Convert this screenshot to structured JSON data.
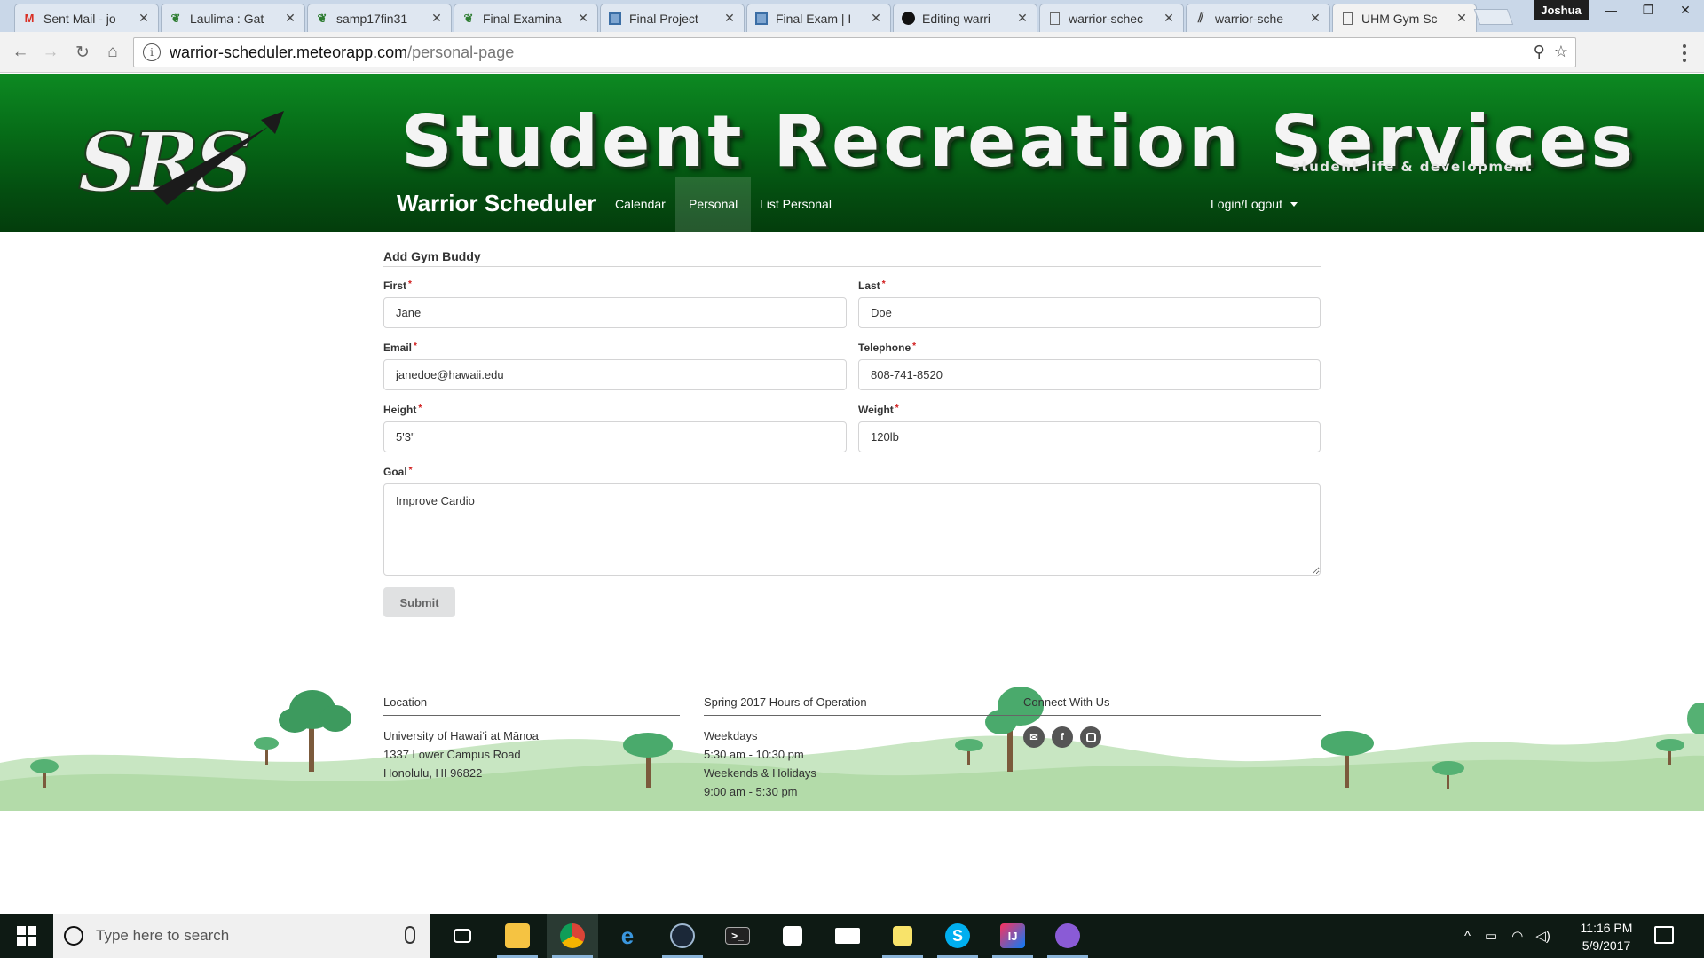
{
  "browser": {
    "tabs": [
      {
        "title": "Sent Mail - jo",
        "icon": "gmail-icon",
        "icon_color": "#d93025"
      },
      {
        "title": "Laulima : Gat",
        "icon": "laulima-icon",
        "icon_color": "#2e7d32"
      },
      {
        "title": "samp17fin31",
        "icon": "laulima-icon",
        "icon_color": "#2e7d32"
      },
      {
        "title": "Final Examina",
        "icon": "laulima-icon",
        "icon_color": "#2e7d32"
      },
      {
        "title": "Final Project",
        "icon": "course-icon",
        "icon_color": "#3b6ea5"
      },
      {
        "title": "Final Exam | I",
        "icon": "course-icon",
        "icon_color": "#3b6ea5"
      },
      {
        "title": "Editing warri",
        "icon": "github-icon",
        "icon_color": "#111111"
      },
      {
        "title": "warrior-schec",
        "icon": "page-icon",
        "icon_color": "#666666"
      },
      {
        "title": "warrior-sche",
        "icon": "meteor-icon",
        "icon_color": "#444444"
      },
      {
        "title": "UHM Gym Sc",
        "icon": "page-icon",
        "icon_color": "#666666"
      }
    ],
    "profile_name": "Joshua",
    "url_host": "warrior-scheduler.meteorapp.com",
    "url_path": "/personal-page"
  },
  "banner": {
    "logo_text": "SRS",
    "title": "Student Recreation Services",
    "subtitle": "student life & development"
  },
  "nav": {
    "brand": "Warrior Scheduler",
    "links": [
      "Calendar",
      "Personal",
      "List Personal"
    ],
    "active_link": "Personal",
    "login_label": "Login/Logout"
  },
  "form": {
    "header": "Add Gym Buddy",
    "fields": {
      "first": {
        "label": "First",
        "value": "Jane"
      },
      "last": {
        "label": "Last",
        "value": "Doe"
      },
      "email": {
        "label": "Email",
        "value": "janedoe@hawaii.edu"
      },
      "telephone": {
        "label": "Telephone",
        "value": "808-741-8520"
      },
      "height": {
        "label": "Height",
        "value": "5'3\""
      },
      "weight": {
        "label": "Weight",
        "value": "120lb"
      },
      "goal": {
        "label": "Goal",
        "value": "Improve Cardio"
      }
    },
    "required_mark": "*",
    "submit_label": "Submit"
  },
  "footer": {
    "location": {
      "heading": "Location",
      "lines": [
        "University of Hawai‘i at Mānoa",
        "1337 Lower Campus Road",
        "Honolulu, HI 96822"
      ]
    },
    "hours": {
      "heading": "Spring 2017 Hours of Operation",
      "lines": [
        "Weekdays",
        "5:30 am - 10:30 pm",
        "Weekends & Holidays",
        "9:00 am - 5:30 pm"
      ]
    },
    "connect": {
      "heading": "Connect With Us",
      "icons": [
        "email-icon",
        "facebook-icon",
        "instagram-icon"
      ]
    }
  },
  "taskbar": {
    "search_placeholder": "Type here to search",
    "apps": [
      "task-view-icon",
      "file-explorer-icon",
      "chrome-icon",
      "edge-icon",
      "steam-icon",
      "terminal-icon",
      "store-icon",
      "mail-icon",
      "sticky-notes-icon",
      "skype-icon",
      "intellij-icon",
      "github-desktop-icon"
    ],
    "time": "11:16 PM",
    "date": "5/9/2017"
  },
  "colors": {
    "banner_green": "#066a17",
    "nav_text": "#ffffff",
    "required": "#d01919",
    "submit_bg": "#e0e1e2",
    "footer_grass": "#c8e6c2",
    "taskbar": "#0e1a14"
  }
}
